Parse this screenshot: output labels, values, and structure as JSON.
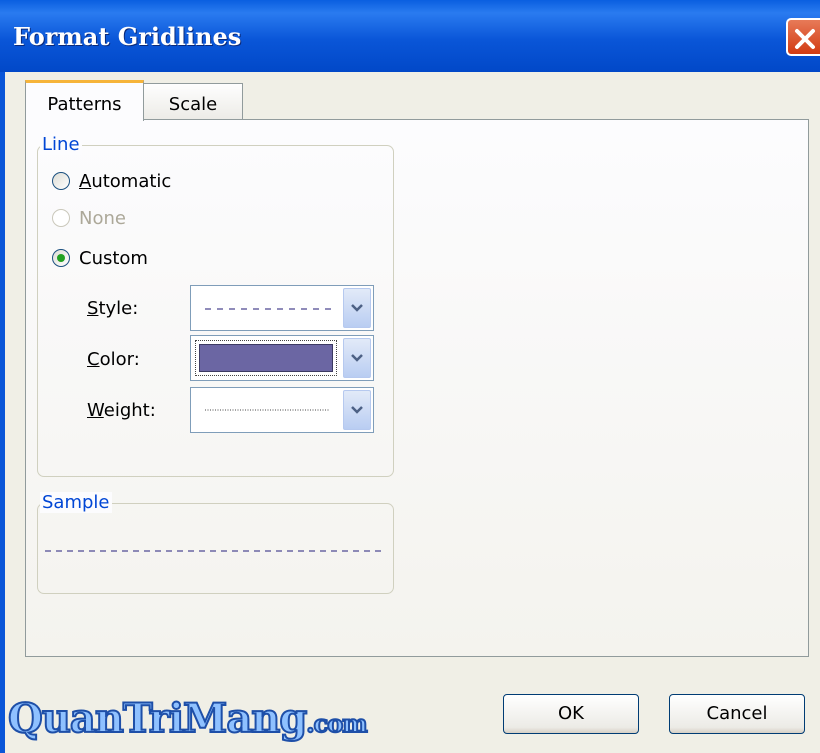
{
  "window": {
    "title": "Format Gridlines"
  },
  "tabs": [
    {
      "label": "Patterns",
      "active": true
    },
    {
      "label": "Scale",
      "active": false
    }
  ],
  "line_group": {
    "legend": "Line",
    "options": [
      {
        "label": "Automatic",
        "selected": false,
        "enabled": true
      },
      {
        "label": "None",
        "selected": false,
        "enabled": false
      },
      {
        "label": "Custom",
        "selected": true,
        "enabled": true
      }
    ],
    "style_label": "Style:",
    "color_label": "Color:",
    "weight_label": "Weight:",
    "style_value": "dashed",
    "color_value": "#6b66a3",
    "weight_value": "hairline-dotted"
  },
  "sample_group": {
    "legend": "Sample"
  },
  "buttons": {
    "ok": "OK",
    "cancel": "Cancel"
  },
  "watermark": {
    "main": "QuanTriMang",
    "suffix": ".com"
  },
  "colors": {
    "title_bar": "#0a56d8",
    "accent_tab": "#f6b43a",
    "group_legend": "#0046d5",
    "line_color": "#6b66a3"
  }
}
